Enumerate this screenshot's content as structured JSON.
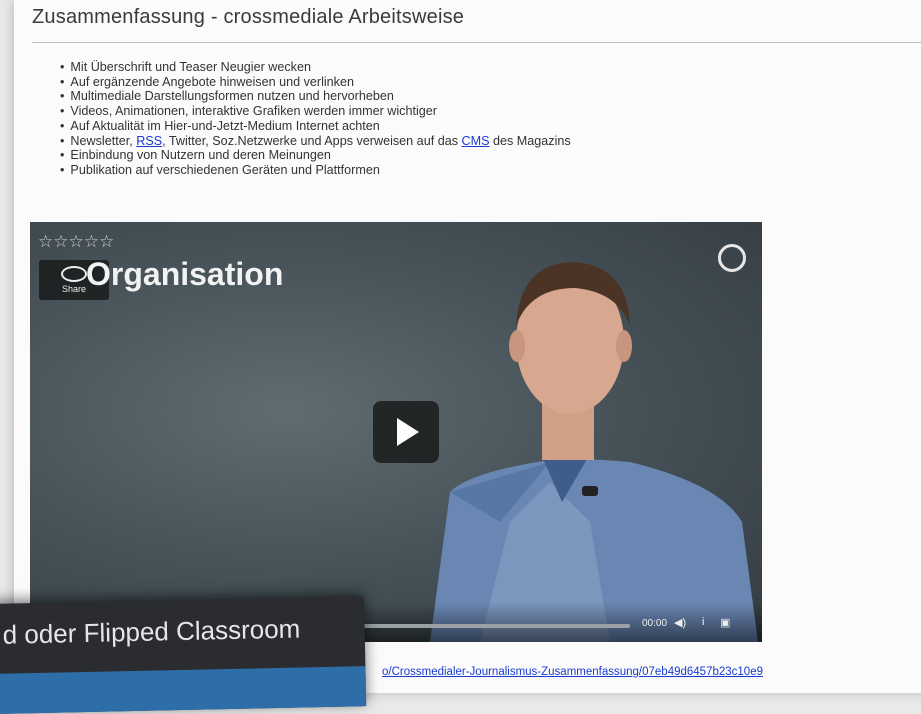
{
  "heading": "Zusammenfassung - crossmediale Arbeitsweise",
  "bullets": {
    "b1": "Mit Überschrift und Teaser Neugier wecken",
    "b2": "Auf ergänzende Angebote hinweisen und verlinken",
    "b3": "Multimediale Darstellungsformen nutzen und hervorheben",
    "b4": "Videos, Animationen, interaktive Grafiken werden immer wichtiger",
    "b5": "Auf Aktualität im Hier-und-Jetzt-Medium Internet achten",
    "b6_pre": "Newsletter, ",
    "b6_rss": "RSS",
    "b6_mid": ", Twitter, Soz.Netzwerke und Apps verweisen auf das ",
    "b6_cms": "CMS",
    "b6_post": " des Magazins",
    "b7": "Einbindung von Nutzern und deren Meinungen",
    "b8": "Publikation auf verschiedenen Geräten und Plattformen"
  },
  "video": {
    "title": "Organisation",
    "rating_stars": "☆☆☆☆☆",
    "share_label": "Share",
    "time": "00:00",
    "volume_icon": "◀)",
    "info_icon": "i",
    "fullscreen_icon": "▣"
  },
  "url_text": "o/Crossmedialer-Journalismus-Zusammenfassung/07eb49d6457b23c10e9",
  "overlay_title": "d oder Flipped Classroom"
}
